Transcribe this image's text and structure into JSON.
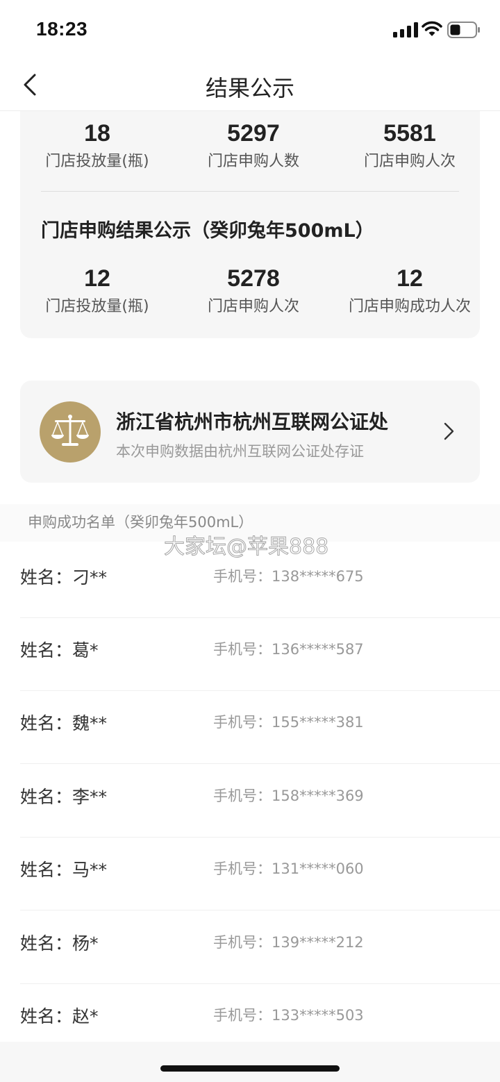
{
  "status": {
    "time": "18:23"
  },
  "nav": {
    "title": "结果公示"
  },
  "stats_top": [
    {
      "value": "18",
      "label": "门店投放量(瓶)"
    },
    {
      "value": "5297",
      "label": "门店申购人数"
    },
    {
      "value": "5581",
      "label": "门店申购人次"
    }
  ],
  "section": {
    "title": "门店申购结果公示（癸卯兔年500mL）"
  },
  "stats_bottom": [
    {
      "value": "12",
      "label": "门店投放量(瓶)"
    },
    {
      "value": "5278",
      "label": "门店申购人次"
    },
    {
      "value": "12",
      "label": "门店申购成功人次"
    }
  ],
  "notary": {
    "title": "浙江省杭州市杭州互联网公证处",
    "subtitle": "本次申购数据由杭州互联网公证处存证"
  },
  "list": {
    "header": "申购成功名单（癸卯兔年500mL）",
    "watermark": "大家坛@苹果888",
    "rows": [
      {
        "name": "姓名：刁**",
        "phone": "手机号：138*****675"
      },
      {
        "name": "姓名：葛*",
        "phone": "手机号：136*****587"
      },
      {
        "name": "姓名：魏**",
        "phone": "手机号：155*****381"
      },
      {
        "name": "姓名：李**",
        "phone": "手机号：158*****369"
      },
      {
        "name": "姓名：马**",
        "phone": "手机号：131*****060"
      },
      {
        "name": "姓名：杨*",
        "phone": "手机号：139*****212"
      },
      {
        "name": "姓名：赵*",
        "phone": "手机号：133*****503"
      }
    ]
  },
  "colors": {
    "badge": "#b9a16c",
    "card_bg": "#f6f6f6"
  },
  "icons": [
    "signal-icon",
    "wifi-icon",
    "battery-icon",
    "back-icon",
    "scale-icon",
    "chevron-right-icon"
  ]
}
